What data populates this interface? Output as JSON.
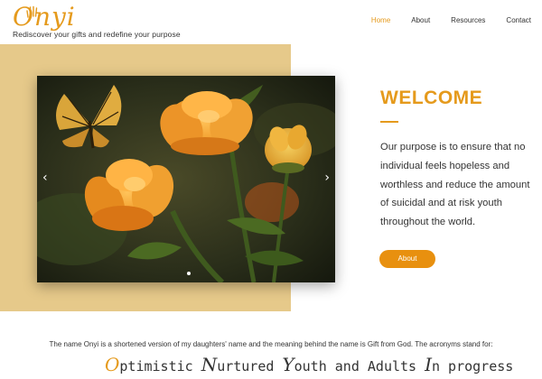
{
  "header": {
    "logo_text": "Onyi",
    "tagline": "Rediscover your gifts and redefine your purpose",
    "nav": [
      {
        "label": "Home",
        "active": true
      },
      {
        "label": "About",
        "active": false
      },
      {
        "label": "Resources",
        "active": false
      },
      {
        "label": "Contact",
        "active": false
      }
    ]
  },
  "hero": {
    "heading": "WELCOME",
    "body": "Our purpose is to ensure that no individual feels hopeless and worthless and reduce the amount of suicidal and at risk youth throughout the world.",
    "button_label": "About",
    "slider": {
      "prev_icon": "‹",
      "next_icon": "›",
      "image": "orange-flowers-with-butterfly"
    }
  },
  "about_name": {
    "text": "The name Onyi is a shortened version of my daughters' name and the meaning behind the name is Gift from God. The acronyms stand for:",
    "acronyms": [
      {
        "initial": "O",
        "rest": "ptimistic"
      },
      {
        "initial": "N",
        "rest": "urtured"
      },
      {
        "initial": "Y",
        "rest": "outh and Adults"
      },
      {
        "initial": "I",
        "rest": "n progress"
      }
    ]
  },
  "colors": {
    "accent": "#e59a1c",
    "tan": "#e6c98a",
    "button": "#e8900f"
  }
}
